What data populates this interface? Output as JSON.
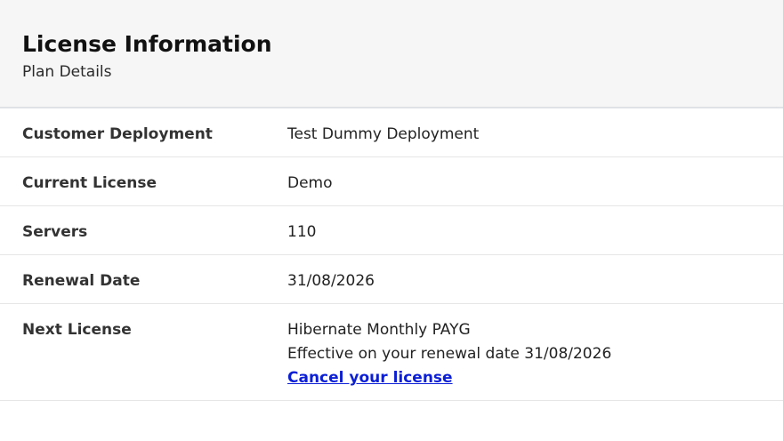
{
  "header": {
    "title": "License Information",
    "subtitle": "Plan Details"
  },
  "details": [
    {
      "label": "Customer Deployment",
      "value": "Test Dummy Deployment"
    },
    {
      "label": "Current License",
      "value": "Demo"
    },
    {
      "label": "Servers",
      "value": "110"
    },
    {
      "label": "Renewal Date",
      "value": "31/08/2026"
    }
  ],
  "next_license": {
    "label": "Next License",
    "plan": "Hibernate Monthly PAYG",
    "effective": "Effective on your renewal date 31/08/2026",
    "cancel_label": "Cancel your license"
  },
  "colors": {
    "header_background": "#f6f6f6",
    "link": "#0b1fd6",
    "divider": "#e6e6e6"
  }
}
